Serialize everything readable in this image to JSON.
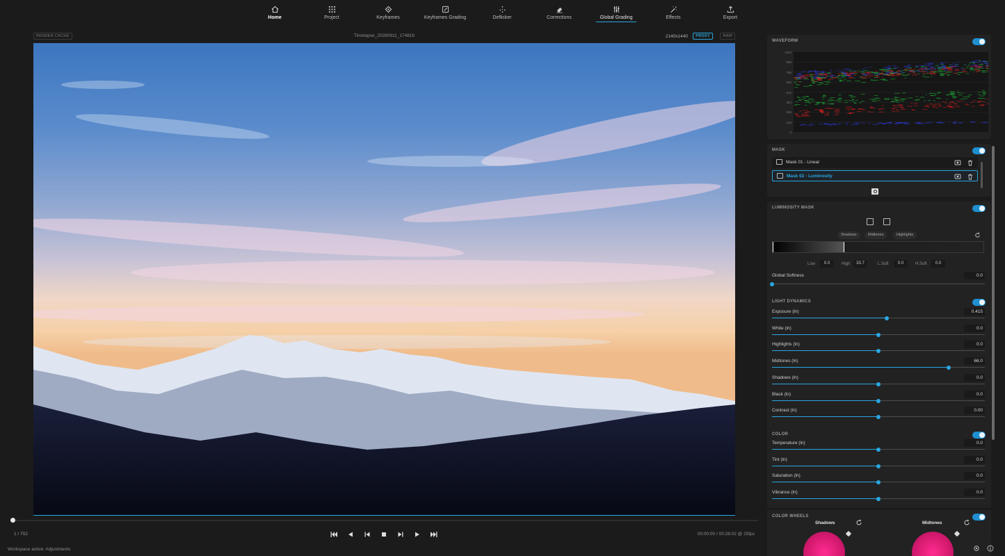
{
  "nav": {
    "items": [
      {
        "label": "Home",
        "icon": "home-icon"
      },
      {
        "label": "Project",
        "icon": "grid-icon"
      },
      {
        "label": "Keyframes",
        "icon": "keyframe-diamond-icon"
      },
      {
        "label": "Keyframes Grading",
        "icon": "edit-pencil-icon"
      },
      {
        "label": "Deflicker",
        "icon": "sparkle-icon"
      },
      {
        "label": "Corrections",
        "icon": "eraser-icon"
      },
      {
        "label": "Global Grading",
        "icon": "sliders-icon"
      },
      {
        "label": "Effects",
        "icon": "magic-wand-icon"
      },
      {
        "label": "Export",
        "icon": "upload-icon"
      }
    ],
    "active": "Global Grading"
  },
  "viewer": {
    "cache_label": "RENDER CACHE",
    "filename": "Timelapse_20260911_174816",
    "resolution": "2140x1440",
    "proxy_label": "PROXY",
    "raw_label": "RAW"
  },
  "playback": {
    "frame_counter": "1 / 702",
    "timecode": "00:00:00 / 00:28:02 @ 25fps",
    "position_fraction": 0.0
  },
  "status": "Workspace active: Adjustments",
  "waveform": {
    "title": "WAVEFORM",
    "enabled": true,
    "scale": [
      "1023",
      "896",
      "768",
      "640",
      "512",
      "384",
      "256",
      "128",
      "0"
    ],
    "colors": {
      "red": "#ff2020",
      "green": "#20e040",
      "blue": "#3040ff"
    }
  },
  "mask": {
    "title": "MASK",
    "enabled": true,
    "items": [
      {
        "name": "Mask 01 - Linear",
        "selected": false
      },
      {
        "name": "Mask 02 - Luminosity",
        "selected": true
      }
    ]
  },
  "luminosity_mask": {
    "title": "LUMINOSITY MASK",
    "enabled": true,
    "ranges": [
      "Shadows",
      "Midtones",
      "Highlights"
    ],
    "fields": [
      {
        "label": "Low",
        "value": "0.0"
      },
      {
        "label": "High",
        "value": "33.7"
      },
      {
        "label": "L.Soft",
        "value": "0.0"
      },
      {
        "label": "H.Soft",
        "value": "0.0"
      }
    ],
    "global_softness": {
      "label": "Global Softness",
      "value": "0.0",
      "position": 0.0
    }
  },
  "light_dynamics": {
    "title": "LIGHT DYNAMICS",
    "enabled": true,
    "sliders": [
      {
        "label": "Exposure (ln)",
        "value": "0.415",
        "position": 0.54
      },
      {
        "label": "White (ln)",
        "value": "0.0",
        "position": 0.5
      },
      {
        "label": "Highlights (ln)",
        "value": "0.0",
        "position": 0.5
      },
      {
        "label": "Midtones (ln)",
        "value": "66.0",
        "position": 0.83
      },
      {
        "label": "Shadows (ln)",
        "value": "0.0",
        "position": 0.5
      },
      {
        "label": "Black (ln)",
        "value": "0.0",
        "position": 0.5
      },
      {
        "label": "Contrast (ln)",
        "value": "0.00",
        "position": 0.5
      }
    ]
  },
  "color": {
    "title": "COLOR",
    "enabled": true,
    "sliders": [
      {
        "label": "Temperature (ln)",
        "value": "0.0",
        "position": 0.5
      },
      {
        "label": "Tint (ln)",
        "value": "0.0",
        "position": 0.5
      },
      {
        "label": "Saturation (ln)",
        "value": "0.0",
        "position": 0.5
      },
      {
        "label": "Vibrance (ln)",
        "value": "0.0",
        "position": 0.5
      }
    ]
  },
  "color_wheels": {
    "title": "COLOR WHEELS",
    "enabled": true,
    "wheels": [
      {
        "label": "Shadows"
      },
      {
        "label": "Midtones"
      }
    ]
  },
  "accent_color": "#29a7e1"
}
